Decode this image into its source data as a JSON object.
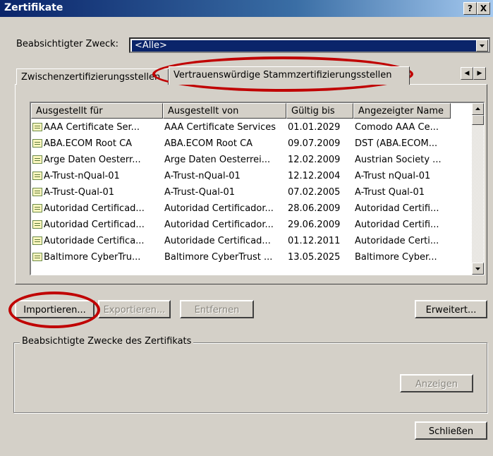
{
  "window": {
    "title": "Zertifikate",
    "help_btn": "?",
    "close_btn": "X"
  },
  "purpose": {
    "label": "Beabsichtigter Zweck:",
    "value": "<Alle>"
  },
  "tabs": [
    {
      "label": "Zwischenzertifizierungsstellen"
    },
    {
      "label": "Vertrauenswürdige Stammzertifizierungsstellen"
    }
  ],
  "tab_scroll": {
    "left": "◀",
    "right": "▶"
  },
  "list": {
    "columns": [
      "Ausgestellt für",
      "Ausgestellt von",
      "Gültig bis",
      "Angezeigter Name"
    ],
    "rows": [
      [
        "AAA Certificate Ser...",
        "AAA Certificate Services",
        "01.01.2029",
        "Comodo AAA Ce..."
      ],
      [
        "ABA.ECOM Root CA",
        "ABA.ECOM Root CA",
        "09.07.2009",
        "DST (ABA.ECOM..."
      ],
      [
        "Arge Daten Oesterr...",
        "Arge Daten Oesterrei...",
        "12.02.2009",
        "Austrian Society ..."
      ],
      [
        "A-Trust-nQual-01",
        "A-Trust-nQual-01",
        "12.12.2004",
        "A-Trust nQual-01"
      ],
      [
        "A-Trust-Qual-01",
        "A-Trust-Qual-01",
        "07.02.2005",
        "A-Trust Qual-01"
      ],
      [
        "Autoridad Certificad...",
        "Autoridad Certificador...",
        "28.06.2009",
        "Autoridad Certifi..."
      ],
      [
        "Autoridad Certificad...",
        "Autoridad Certificador...",
        "29.06.2009",
        "Autoridad Certifi..."
      ],
      [
        "Autoridade Certifica...",
        "Autoridade Certificad...",
        "01.12.2011",
        "Autoridade Certi..."
      ],
      [
        "Baltimore CyberTru...",
        "Baltimore CyberTrust ...",
        "13.05.2025",
        "Baltimore Cyber..."
      ]
    ]
  },
  "buttons": {
    "import": "Importieren...",
    "export": "Exportieren...",
    "remove": "Entfernen",
    "advanced": "Erweitert...",
    "view": "Anzeigen",
    "close": "Schließen"
  },
  "group": {
    "label": "Beabsichtigte Zwecke des Zertifikats"
  },
  "colors": {
    "title_bar": "#0a246a",
    "annotation": "#c00000",
    "dialog_bg": "#d4d0c8"
  }
}
